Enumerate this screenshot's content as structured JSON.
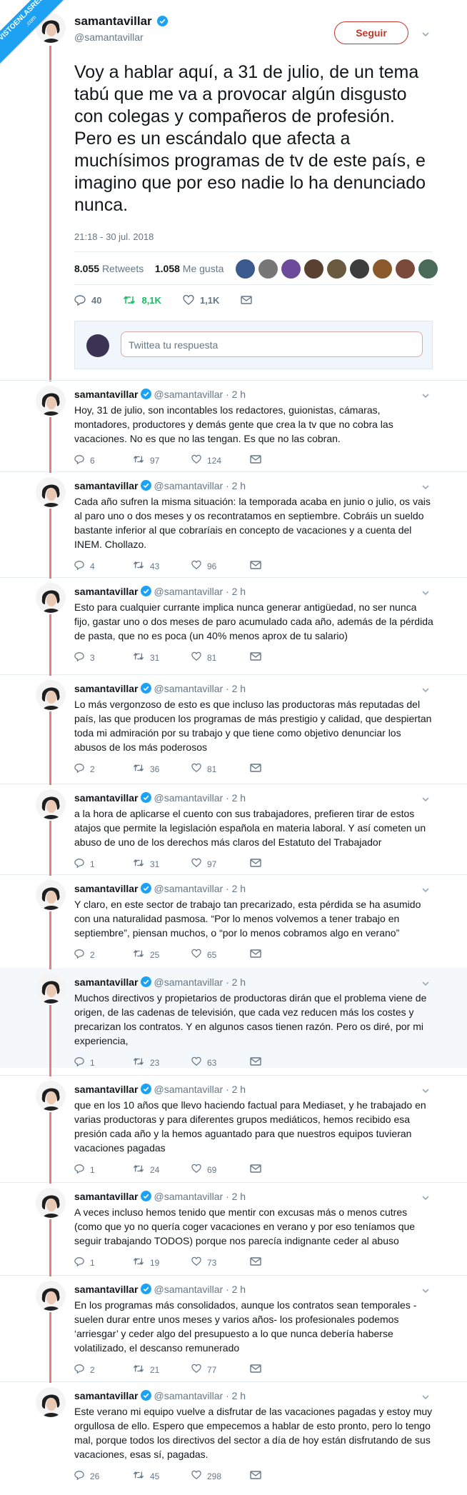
{
  "watermark": {
    "line1": "VISTOENLASREDES",
    "line2": ".com"
  },
  "main_tweet": {
    "name": "samantavillar",
    "handle": "@samantavillar",
    "follow_label": "Seguir",
    "text": "Voy a hablar aquí, a 31 de julio, de un tema tabú que me va a provocar algún disgusto con colegas y compañeros de profesión. Pero es un escándalo que afecta a muchísimos programas de tv de este país, e imagino que por eso nadie lo ha denunciado nunca.",
    "date": "21:18 - 30 jul. 2018",
    "retweets_count": "8.055",
    "retweets_label": "Retweets",
    "likes_count": "1.058",
    "likes_label": "Me gusta",
    "replies": "40",
    "retweets_short": "8,1K",
    "likes_short": "1,1K",
    "liker_colors": [
      "#3b5b8f",
      "#777777",
      "#6b4b9a",
      "#5a4030",
      "#6a5a40",
      "#3d3d3d",
      "#8b5a2b",
      "#7a4a3a",
      "#4a6a5a"
    ]
  },
  "reply_placeholder": "Twittea tu respuesta",
  "thread": [
    {
      "name": "samantavillar",
      "meta": "@samantavillar · 2 h",
      "text": "Hoy, 31 de julio, son incontables los redactores, guionistas, cámaras, montadores, productores y demás gente que crea la tv que no cobra las vacaciones. No es que no las tengan. Es que no las cobran.",
      "replies": "6",
      "retweets": "97",
      "likes": "124"
    },
    {
      "name": "samantavillar",
      "meta": "@samantavillar · 2 h",
      "text": "Cada año sufren la misma situación: la temporada acaba en junio o julio, os vais al paro uno o dos meses y os recontratamos en septiembre. Cobráis un sueldo bastante inferior al que cobraríais en concepto de vacaciones y a cuenta del INEM. Chollazo.",
      "replies": "4",
      "retweets": "43",
      "likes": "96"
    },
    {
      "name": "samantavillar",
      "meta": "@samantavillar · 2 h",
      "text": "Esto para cualquier currante implica nunca generar antigüedad, no ser nunca fijo, gastar uno o dos meses de paro acumulado cada año, además de la pérdida de pasta, que no es poca (un 40% menos aprox de tu salario)",
      "replies": "3",
      "retweets": "31",
      "likes": "81"
    },
    {
      "name": "samantavillar",
      "meta": "@samantavillar · 2 h",
      "text": "Lo más vergonzoso de esto es que incluso las productoras más reputadas del país, las que producen los programas de más prestigio y calidad, que despiertan toda mi admiración por su trabajo y que tiene como objetivo denunciar los abusos de los más poderosos",
      "replies": "2",
      "retweets": "36",
      "likes": "81"
    },
    {
      "name": "samantavillar",
      "meta": "@samantavillar · 2 h",
      "text": "a la hora de aplicarse el cuento con sus trabajadores, prefieren tirar de estos atajos que permite la legislación española en materia laboral. Y así cometen un abuso de uno de los derechos más claros del Estatuto del Trabajador",
      "replies": "1",
      "retweets": "31",
      "likes": "97"
    },
    {
      "name": "samantavillar",
      "meta": "@samantavillar · 2 h",
      "text": "Y claro, en este sector de trabajo tan precarizado, esta pérdida se ha asumido con una naturalidad pasmosa. “Por lo menos volvemos a tener trabajo en septiembre”, piensan muchos, o “por lo menos cobramos algo en verano”",
      "replies": "2",
      "retweets": "25",
      "likes": "65"
    },
    {
      "name": "samantavillar",
      "meta": "@samantavillar · 2 h",
      "text": "Muchos directivos y propietarios de productoras dirán que el problema viene de origen, de las cadenas de televisión, que cada vez reducen más los costes y precarizan los contratos. Y en algunos casos tienen razón. Pero os diré, por mi experiencia,",
      "replies": "1",
      "retweets": "23",
      "likes": "63"
    },
    {
      "name": "samantavillar",
      "meta": "@samantavillar · 2 h",
      "text": "que en los 10 años que llevo haciendo factual para Mediaset, y he trabajado en varias productoras y para diferentes grupos mediáticos, hemos recibido esa presión cada año y la hemos aguantado para que nuestros equipos tuvieran vacaciones pagadas",
      "replies": "1",
      "retweets": "24",
      "likes": "69"
    },
    {
      "name": "samantavillar",
      "meta": "@samantavillar · 2 h",
      "text": "A veces incluso hemos tenido que mentir con excusas más o menos cutres (como que yo no quería coger vacaciones en verano y por eso teníamos que seguir trabajando TODOS) porque nos parecía indignante ceder al abuso",
      "replies": "1",
      "retweets": "19",
      "likes": "73"
    },
    {
      "name": "samantavillar",
      "meta": "@samantavillar · 2 h",
      "text": "En los programas más consolidados, aunque los contratos sean temporales - suelen durar entre unos meses y varios años- los profesionales podemos ‘arriesgar’ y ceder algo del presupuesto a lo que nunca debería haberse volatilizado, el descanso remunerado",
      "replies": "2",
      "retweets": "21",
      "likes": "77"
    },
    {
      "name": "samantavillar",
      "meta": "@samantavillar · 2 h",
      "text": "Este verano mi equipo vuelve a disfrutar de las vacaciones pagadas y estoy muy orgullosa de ello. Espero que empecemos a hablar de esto pronto, pero lo tengo mal, porque todos los directivos del sector a día de hoy están disfrutando de sus vacaciones, esas sí, pagadas.",
      "replies": "26",
      "retweets": "45",
      "likes": "298"
    }
  ],
  "colors": {
    "accent": "#1da1f2",
    "follow": "#c0392b",
    "thread_line": "#e58080",
    "retweet_active": "#17bf63"
  }
}
